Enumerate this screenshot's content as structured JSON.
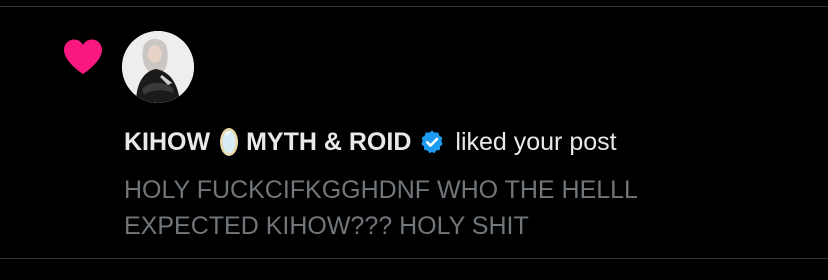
{
  "notification": {
    "type_icon": "heart-icon",
    "accent_color": "#f91880",
    "avatar_icon": "profile-avatar",
    "user_name_part1": "KIHOW",
    "name_emoji_icon": "mirror-icon",
    "user_name_part2": "MYTH & ROID",
    "verified_icon": "verified-badge-icon",
    "verified_color": "#1d9bf0",
    "action_text": "liked your post",
    "post_text": "HOLY FUCKCIFKGGHDNF WHO THE HELLL\nEXPECTED KIHOW??? HOLY SHIT",
    "secondary_text_color": "#71767b"
  }
}
